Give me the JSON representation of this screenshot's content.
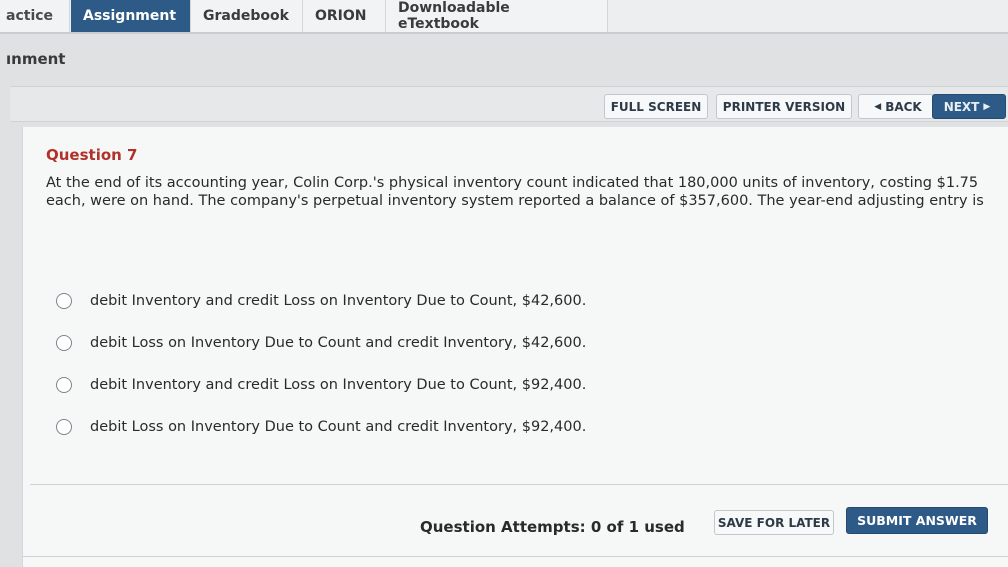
{
  "tabs": [
    {
      "label": "actice",
      "active": false
    },
    {
      "label": "Assignment",
      "active": true
    },
    {
      "label": "Gradebook",
      "active": false
    },
    {
      "label": "ORION",
      "active": false
    },
    {
      "label": "Downloadable eTextbook",
      "active": false
    }
  ],
  "page": {
    "title": "ınment"
  },
  "toolbar": {
    "full_screen": "FULL SCREEN",
    "printer_version": "PRINTER VERSION",
    "back": "BACK",
    "next": "NEXT"
  },
  "question": {
    "label": "Question 7",
    "text": "At the end of its accounting year, Colin Corp.'s physical inventory count indicated that 180,000 units of inventory, costing $1.75 each, were on hand. The company's perpetual inventory system reported a balance of $357,600. The year-end adjusting entry is",
    "options": [
      "debit Inventory and credit Loss on Inventory Due to Count, $42,600.",
      "debit Loss on Inventory Due to Count and credit Inventory, $42,600.",
      "debit Inventory and credit Loss on Inventory Due to Count, $92,400.",
      "debit Loss on Inventory Due to Count and credit Inventory, $92,400."
    ]
  },
  "footer": {
    "attempts": "Question Attempts: 0 of 1 used",
    "save_later": "SAVE FOR LATER",
    "submit": "SUBMIT ANSWER"
  },
  "colors": {
    "accent": "#2e5a87",
    "question_label": "#b0322a"
  },
  "icons": [
    "back-arrow-icon",
    "next-arrow-icon",
    "radio-empty-icon"
  ]
}
